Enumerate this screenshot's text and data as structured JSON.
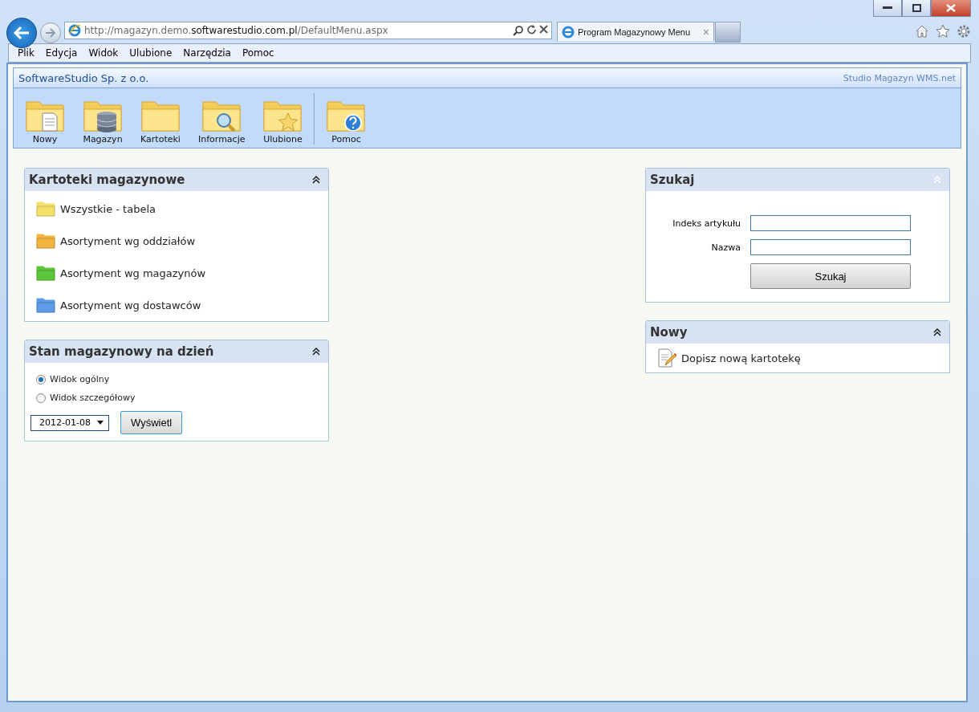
{
  "browser": {
    "address": {
      "prefix": "http://magazyn.demo.",
      "domain": "softwarestudio.com.pl",
      "path": "/DefaultMenu.aspx"
    },
    "tab": {
      "title": "Program Magazynowy Menu",
      "close": "×"
    },
    "menu": [
      "Plik",
      "Edycja",
      "Widok",
      "Ulubione",
      "Narzędzia",
      "Pomoc"
    ]
  },
  "app": {
    "company": "SoftwareStudio Sp. z o.o.",
    "product": "Studio Magazyn WMS.net",
    "toolbar": [
      {
        "label": "Nowy",
        "separator_before": false
      },
      {
        "label": "Magazyn",
        "separator_before": false
      },
      {
        "label": "Kartoteki",
        "separator_before": false
      },
      {
        "label": "Informacje",
        "separator_before": false
      },
      {
        "label": "Ulubione",
        "separator_before": false
      },
      {
        "label": "Pomoc",
        "separator_before": true
      }
    ]
  },
  "left_panels": [
    {
      "kind": "links",
      "title": "Kartoteki magazynowe",
      "collapse_dimmed": false,
      "items": [
        {
          "label": "Wszystkie - tabela",
          "color": "#f5e16a"
        },
        {
          "label": "Asortyment wg oddziałów",
          "color": "#f2b441"
        },
        {
          "label": "Asortyment wg magazynów",
          "color": "#5cc63a"
        },
        {
          "label": "Asortyment wg dostawców",
          "color": "#5c9be6"
        }
      ]
    },
    {
      "kind": "stock",
      "title": "Stan magazynowy na dzień",
      "collapse_dimmed": false,
      "options": [
        {
          "label": "Widok ogólny",
          "selected": true
        },
        {
          "label": "Widok szczegółowy",
          "selected": false
        }
      ],
      "date": "2012-01-08",
      "button": "Wyświetl"
    }
  ],
  "right_panels": [
    {
      "kind": "search",
      "title": "Szukaj",
      "collapse_dimmed": true,
      "fields": [
        {
          "label": "Indeks artykułu"
        },
        {
          "label": "Nazwa"
        }
      ],
      "button": "Szukaj"
    },
    {
      "kind": "new",
      "title": "Nowy",
      "collapse_dimmed": false,
      "link": "Dopisz nową kartotekę"
    }
  ]
}
